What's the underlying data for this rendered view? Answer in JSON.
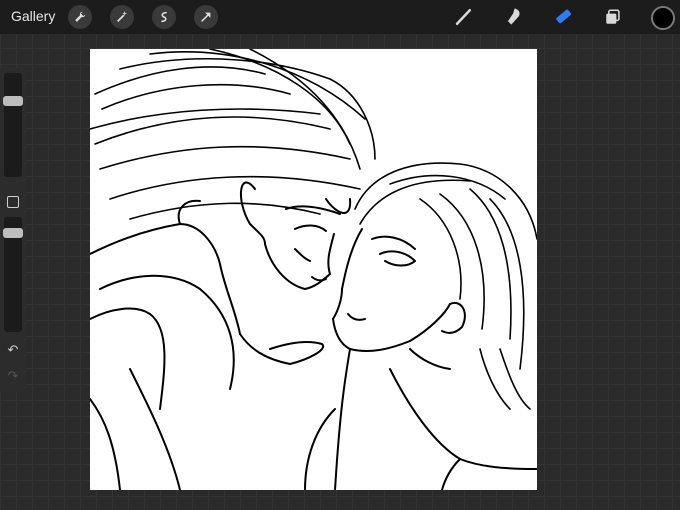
{
  "topbar": {
    "gallery_label": "Gallery",
    "left_tools": [
      "wrench-icon",
      "magic-wand-icon",
      "selection-icon",
      "transform-arrow-icon"
    ],
    "right_tools": [
      "brush-icon",
      "smudge-icon",
      "eraser-icon",
      "layers-icon"
    ],
    "active_tool": "eraser-icon",
    "accent_color": "#2f7df6",
    "current_color": "#000000"
  },
  "sidebar": {
    "controls": [
      "brush-size-slider",
      "modify-button",
      "opacity-slider",
      "undo-icon",
      "redo-icon"
    ]
  },
  "canvas": {
    "background": "#ffffff"
  }
}
